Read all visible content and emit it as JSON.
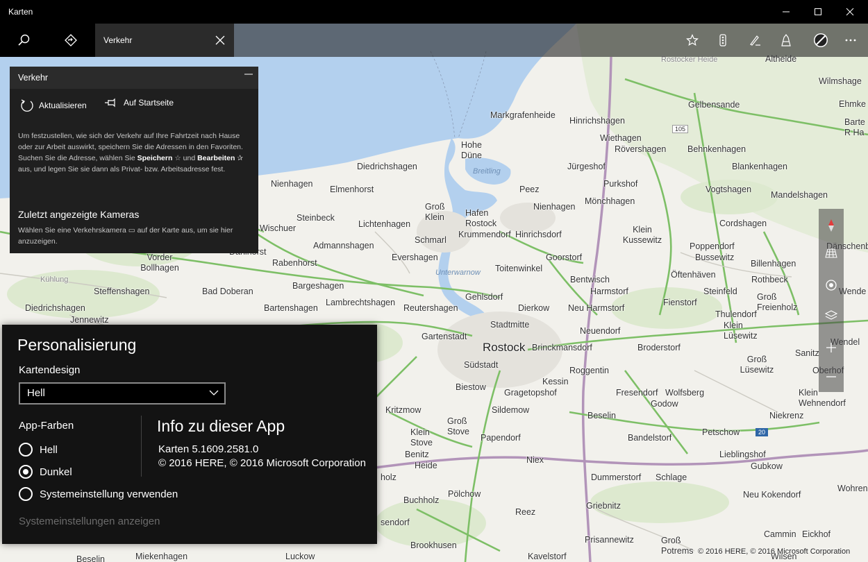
{
  "window": {
    "title": "Karten",
    "minimize": "─",
    "maximize": "☐",
    "close": "✕"
  },
  "toolbar": {
    "search_icon": "search-icon",
    "directions_icon": "directions-icon",
    "search_tab_label": "Verkehr",
    "right_icons": [
      "star-icon",
      "traffic-icon",
      "ink-icon",
      "3d-cities-icon",
      "streetside-icon",
      "more-icon"
    ]
  },
  "traffic_panel": {
    "title": "Verkehr",
    "refresh_label": "Aktualisieren",
    "pin_label": "Auf Startseite",
    "desc_1": "Um festzustellen, wie sich der Verkehr auf Ihre Fahrtzeit nach Hause oder zur Arbeit auswirkt, speichern Sie die Adressen in den Favoriten. Suchen Sie die Adresse, wählen Sie ",
    "desc_save": "Speichern",
    "desc_2": " und ",
    "desc_edit": "Bearbeiten",
    "desc_3": " aus, und legen Sie sie dann als Privat- bzw. Arbeitsadresse fest.",
    "cameras_heading": "Zuletzt angezeigte Kameras",
    "cameras_desc_1": "Wählen Sie eine Verkehrskamera ",
    "cameras_desc_2": " auf der Karte aus, um sie hier anzuzeigen."
  },
  "personalization": {
    "title": "Personalisierung",
    "map_design_label": "Kartendesign",
    "map_design_value": "Hell",
    "app_colors_label": "App-Farben",
    "options": [
      {
        "label": "Hell",
        "selected": false
      },
      {
        "label": "Dunkel",
        "selected": true
      },
      {
        "label": "Systemeinstellung verwenden",
        "selected": false
      }
    ],
    "system_settings_link": "Systemeinstellungen anzeigen",
    "about_title": "Info zu dieser App",
    "version": "Karten 5.1609.2581.0",
    "copyright": "© 2016 HERE, © 2016 Microsoft Corporation"
  },
  "map": {
    "copyright": "© 2016 HERE, © 2016 Microsoft Corporation",
    "places": [
      "Rostocker Heide",
      "Altheide",
      "Wilmshage",
      "Ehmke",
      "Barte",
      "R Ha",
      "Markgrafenheide",
      "Gelbensande",
      "Hinrichshagen",
      "Wiethagen",
      "Hohe Düne",
      "Röversha­gen",
      "Behnkenhagen",
      "Diedrichshagen",
      "Jürgeshof",
      "Blankenhagen",
      "Nienhagen",
      "Elmenhorst",
      "Peez",
      "Purkshof",
      "Vogtshagen",
      "Mandelshagen",
      "Nienhagen",
      "Groß Klein",
      "Hafen Rostock",
      "Mönchhagen",
      "Steinbeck",
      "Lichtenhagen",
      "Wischuer",
      "Schmarl",
      "Krummendorf",
      "Hinrichsdorf",
      "Klein Kussewitz",
      "Cordshagen",
      "Admannshagen",
      "Dänschenburg",
      "Poppendorf",
      "Dahl­horst",
      "Evershagen",
      "Toitenwinkel",
      "Goorstorf",
      "Bussewitz",
      "Billenhagen",
      "Vorder Bollhagen",
      "Rabenhorst",
      "Öftenhäven",
      "Kühlung",
      "Steffenshagen",
      "Bargeshagen",
      "Bentwisch",
      "Rothbeck",
      "Bad Doberan",
      "Harmstorf",
      "Steinfeld",
      "Wende",
      "Gehlsdorf",
      "Fienstorf",
      "Groß Freienholz",
      "Diedrichshagen",
      "Bartenshagen",
      "Lambrechtshagen",
      "Reutershagen",
      "Dierkow",
      "Neu Harmstorf",
      "Thulendorf",
      "Jennewitz",
      "Stadtmitte",
      "Neuendorf",
      "Klein Lüsewitz",
      "Gartenstadt",
      "Rostock",
      "Brinckmansdorf",
      "Broderstorf",
      "Wendel",
      "Südstadt",
      "Roggentin",
      "Sanitz",
      "Groß Lüsewitz",
      "Oberhof",
      "Biestow",
      "Kessin",
      "Gragetopshof",
      "Fresendorf",
      "Wolfsberg",
      "Godow",
      "Klein Wehnendorf",
      "Kritzmow",
      "Sildemow",
      "Beselin",
      "Niekrenz",
      "Groß Stove",
      "Klein Stove",
      "Papendorf",
      "Bandelstorf",
      "Petschow",
      "Lieblingshof",
      "Gubkow",
      "Niex",
      "Benitz",
      "Heide",
      "Dummerstorf",
      "Schlage",
      "holz",
      "Buchholz",
      "Pölchow",
      "Wohren",
      "Neu Kokendorf",
      "Griebnitz",
      "Reez",
      "sendorf",
      "Cammin",
      "Eickhof",
      "Prisannewitz",
      "Brookhusen",
      "Groß Potrems",
      "Miekenhagen",
      "Beselin",
      "Luckow",
      "Kavelstorf",
      "Wilsen"
    ],
    "water_labels": [
      "Breitling",
      "Unterwarnow"
    ],
    "route_numbers": [
      "105",
      "20"
    ]
  },
  "map_controls": [
    "compass-icon",
    "tilt-icon",
    "locate-icon",
    "layers-icon",
    "zoom-in-icon",
    "zoom-out-icon"
  ]
}
